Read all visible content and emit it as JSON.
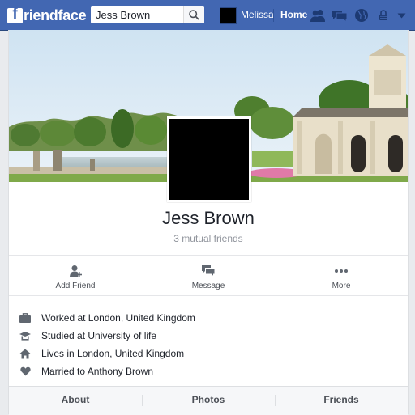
{
  "topbar": {
    "logo_letter": "f",
    "logo_text": "riendface",
    "search_value": "Jess Brown",
    "user_name": "Melissa",
    "home_label": "Home"
  },
  "profile": {
    "name": "Jess Brown",
    "mutual_friends": "3 mutual friends"
  },
  "actions": {
    "add_friend": "Add Friend",
    "message": "Message",
    "more": "More"
  },
  "info": [
    {
      "icon": "briefcase-icon",
      "text": "Worked at London, United Kingdom"
    },
    {
      "icon": "graduation-cap-icon",
      "text": "Studied at University of life"
    },
    {
      "icon": "house-icon",
      "text": "Lives in London, United Kingdom"
    },
    {
      "icon": "heart-icon",
      "text": "Married to Anthony Brown"
    }
  ],
  "tabs": [
    "About",
    "Photos",
    "Friends"
  ],
  "colors": {
    "brand_blue": "#4267b2",
    "icon_gray": "#606770",
    "text_dark": "#1d2129",
    "text_muted": "#90949c"
  }
}
